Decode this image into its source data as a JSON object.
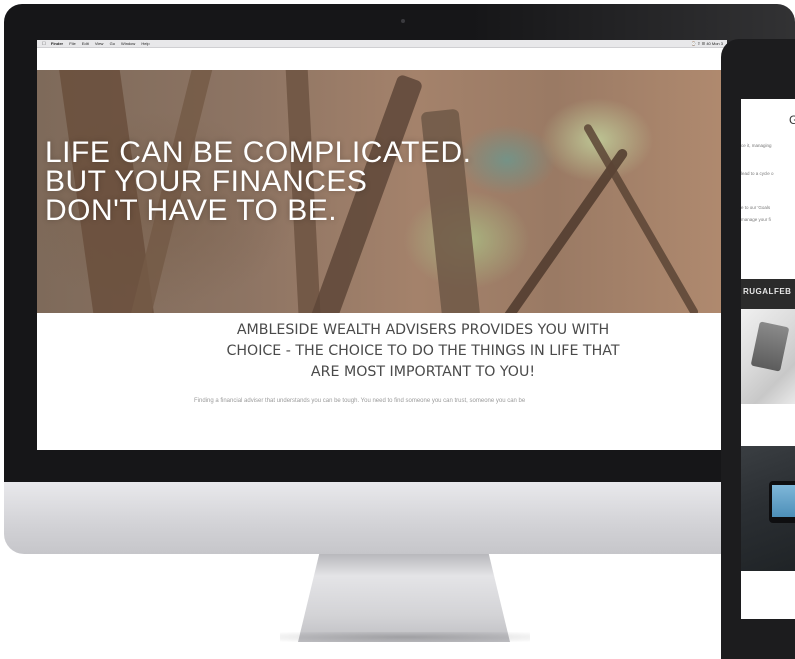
{
  "menubar": {
    "items": [
      "Finder",
      "File",
      "Edit",
      "View",
      "Go",
      "Window",
      "Help"
    ],
    "status": "⌚ ⇪ ☰ 40 Mon 3"
  },
  "hero": {
    "lines": [
      "LIFE CAN BE COMPLICATED.",
      "BUT YOUR FINANCES",
      "DON'T HAVE TO BE."
    ]
  },
  "main": {
    "headline_lines": [
      "AMBLESIDE WEALTH ADVISERS PROVIDES YOU WITH",
      "CHOICE - THE CHOICE TO DO THE THINGS IN LIFE THAT",
      "ARE MOST IMPORTANT TO YOU!"
    ],
    "intro": "Finding a financial adviser that understands you can be tough. You need to find someone you can trust, someone you can be"
  },
  "tablet": {
    "title": "G",
    "lines": [
      "ce it, managing",
      "lead to a cycle o",
      "e to our 'Goals",
      "manage your fi"
    ],
    "banner": "RUGALFEB"
  }
}
